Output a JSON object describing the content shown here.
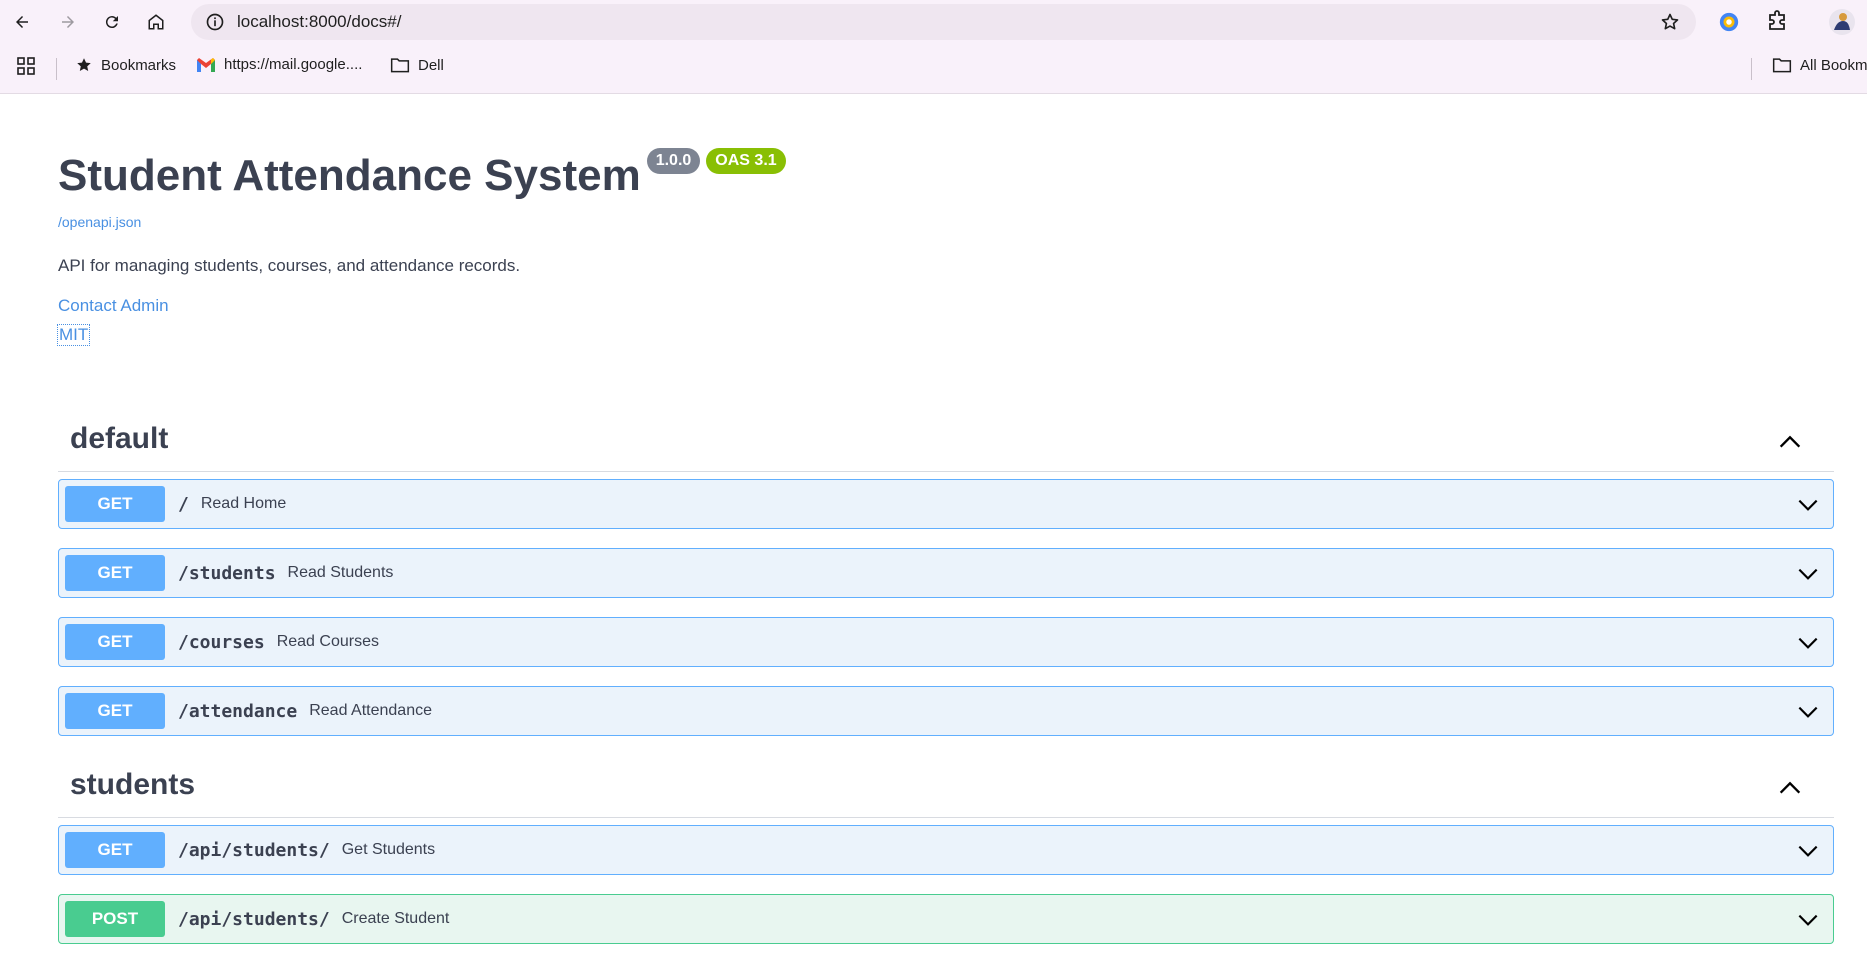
{
  "browser": {
    "url": "localhost:8000/docs#/",
    "bookmarks": [
      {
        "label": "Bookmarks",
        "icon": "star-icon"
      },
      {
        "label": "https://mail.google....",
        "icon": "gmail-icon"
      },
      {
        "label": "Dell",
        "icon": "folder-icon"
      }
    ],
    "all_bookmarks": "All Bookm"
  },
  "api": {
    "title": "Student Attendance System",
    "version": "1.0.0",
    "oas": "OAS 3.1",
    "spec_link": "/openapi.json",
    "description": "API for managing students, courses, and attendance records.",
    "contact": "Contact Admin",
    "license": "MIT"
  },
  "tags": [
    {
      "name": "default",
      "operations": [
        {
          "method": "GET",
          "path": "/",
          "summary": "Read Home"
        },
        {
          "method": "GET",
          "path": "/students",
          "summary": "Read Students"
        },
        {
          "method": "GET",
          "path": "/courses",
          "summary": "Read Courses"
        },
        {
          "method": "GET",
          "path": "/attendance",
          "summary": "Read Attendance"
        }
      ]
    },
    {
      "name": "students",
      "operations": [
        {
          "method": "GET",
          "path": "/api/students/",
          "summary": "Get Students"
        },
        {
          "method": "POST",
          "path": "/api/students/",
          "summary": "Create Student"
        }
      ]
    }
  ],
  "colors": {
    "get": "#61affe",
    "post": "#49cc90",
    "link": "#4990e2"
  }
}
